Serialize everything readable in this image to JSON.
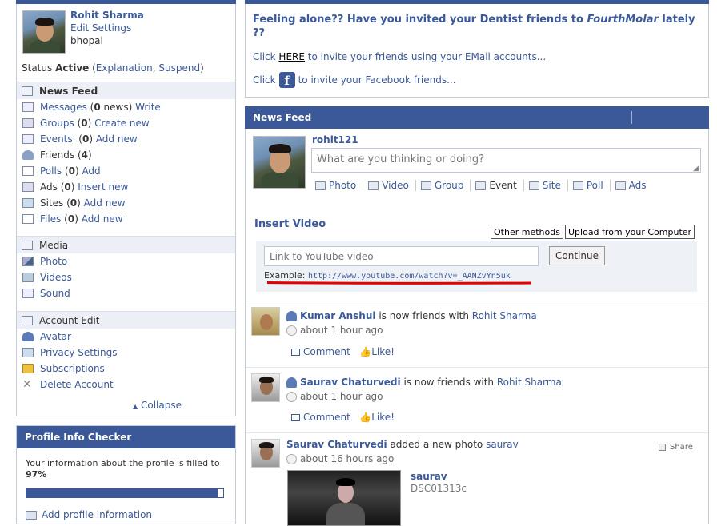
{
  "profile": {
    "name": "Rohit Sharma",
    "edit_settings": "Edit Settings",
    "city": "bhopal",
    "status_label": "Status",
    "status_value": "Active",
    "explanation": "Explanation",
    "suspend": "Suspend"
  },
  "sections": {
    "news_feed": "News Feed",
    "media": "Media",
    "account_edit": "Account Edit"
  },
  "nav": {
    "messages": {
      "label": "Messages",
      "count": "0",
      "count_suffix": "news",
      "action": "Write"
    },
    "groups": {
      "label": "Groups",
      "count": "0",
      "action": "Create new"
    },
    "events": {
      "label": "Events",
      "count": "0",
      "action": "Add new"
    },
    "friends": {
      "label": "Friends",
      "count": "4"
    },
    "polls": {
      "label": "Polls",
      "count": "0",
      "action": "Add"
    },
    "ads": {
      "label": "Ads",
      "count": "0",
      "action": "Insert new"
    },
    "sites": {
      "label": "Sites",
      "count": "0",
      "action": "Add new"
    },
    "files": {
      "label": "Files",
      "count": "0",
      "action": "Add new"
    }
  },
  "media": [
    "Photo",
    "Videos",
    "Sound"
  ],
  "account": [
    "Avatar",
    "Privacy Settings",
    "Subscriptions",
    "Delete Account"
  ],
  "collapse": "Collapse",
  "profile_checker": {
    "title": "Profile Info Checker",
    "text": "Your information about the profile is filled to",
    "percent_text": "97%",
    "percent": 0.97,
    "add_link": "Add profile information"
  },
  "invite": {
    "title_pre": "Feeling alone?? Have you invited your Dentist friends to",
    "brand": "FourthMolar",
    "title_post": "lately ??",
    "email_pre": "Click",
    "email_link": "HERE",
    "email_post": "to invite your friends using your EMail accounts...",
    "fb_pre": "Click",
    "fb_post": "to invite your Facebook friends..."
  },
  "news_feed": {
    "title": "News Feed",
    "me": "rohit121",
    "status_placeholder": "What are you thinking or doing?",
    "attachments": [
      "Photo",
      "Video",
      "Group",
      "Event",
      "Site",
      "Poll",
      "Ads"
    ]
  },
  "insert_video": {
    "title": "Insert Video",
    "other_methods": "Other methods",
    "upload": "Upload from your Computer",
    "input_placeholder": "Link to YouTube video",
    "continue": "Continue",
    "example_label": "Example:",
    "example_url": "http://www.youtube.com/watch?v=_AANZvYn5uk"
  },
  "feed": [
    {
      "actor": "Kumar Anshul",
      "verb": "is now friends with",
      "target": "Rohit Sharma",
      "time": "about 1 hour ago",
      "comment": "Comment",
      "like": "Like!"
    },
    {
      "actor": "Saurav Chaturvedi",
      "verb": "is now friends with",
      "target": "Rohit Sharma",
      "time": "about 1 hour ago",
      "comment": "Comment",
      "like": "Like!"
    },
    {
      "actor": "Saurav Chaturvedi",
      "verb": "added a new photo",
      "target": "saurav",
      "time": "about 16 hours ago",
      "share": "Share",
      "photo_title": "saurav",
      "photo_file": "DSC01313c"
    }
  ],
  "colors": {
    "brand": "#3b5998",
    "highlight": "#e60000"
  }
}
